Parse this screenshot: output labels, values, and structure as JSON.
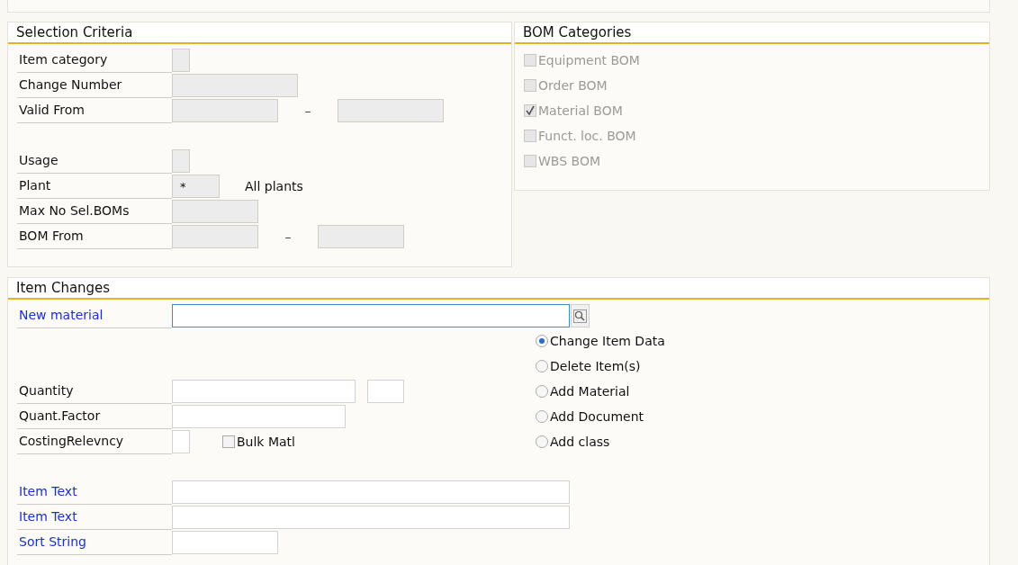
{
  "selection_criteria": {
    "title": "Selection Criteria",
    "groups": [
      [
        {
          "label": "Item category",
          "disabled": true
        },
        {
          "label": "Change Number",
          "disabled": true
        },
        {
          "label": "Valid From",
          "disabled": true,
          "separator": "–"
        }
      ],
      [
        {
          "label": "Usage",
          "disabled": true
        },
        {
          "label": "Plant",
          "disabled": true,
          "value": "*",
          "description": "All plants"
        },
        {
          "label": "Max No Sel.BOMs",
          "disabled": true
        },
        {
          "label": "BOM From",
          "disabled": true,
          "separator": "–"
        }
      ]
    ]
  },
  "bom_categories": {
    "title": "BOM Categories",
    "items": [
      {
        "label": "Equipment BOM",
        "checked": false,
        "disabled": true
      },
      {
        "label": "Order BOM",
        "checked": false,
        "disabled": true
      },
      {
        "label": "Material BOM",
        "checked": true,
        "disabled": true
      },
      {
        "label": "Funct. loc. BOM",
        "checked": false,
        "disabled": true
      },
      {
        "label": "WBS BOM",
        "checked": false,
        "disabled": true
      }
    ]
  },
  "item_changes": {
    "title": "Item Changes",
    "material": {
      "label": "New material",
      "highlighted": true,
      "focused": true
    },
    "entries": [
      {
        "label": "Quantity",
        "highlighted": false,
        "unit_field": true
      },
      {
        "label": "Quant.Factor",
        "highlighted": false
      },
      {
        "label": "CostingRelevncy",
        "highlighted": false,
        "checkbox": {
          "label": "Bulk Matl",
          "checked": false
        }
      }
    ],
    "options": [
      {
        "label": "Change Item Data",
        "selected": true
      },
      {
        "label": "Delete Item(s)",
        "selected": false
      },
      {
        "label": "Add Material",
        "selected": false
      },
      {
        "label": "Add Document",
        "selected": false
      },
      {
        "label": "Add class",
        "selected": false
      }
    ],
    "texts": [
      {
        "label": "Item Text",
        "highlighted": true
      },
      {
        "label": "Item Text",
        "highlighted": true
      },
      {
        "label": "Sort String",
        "highlighted": true
      }
    ]
  }
}
